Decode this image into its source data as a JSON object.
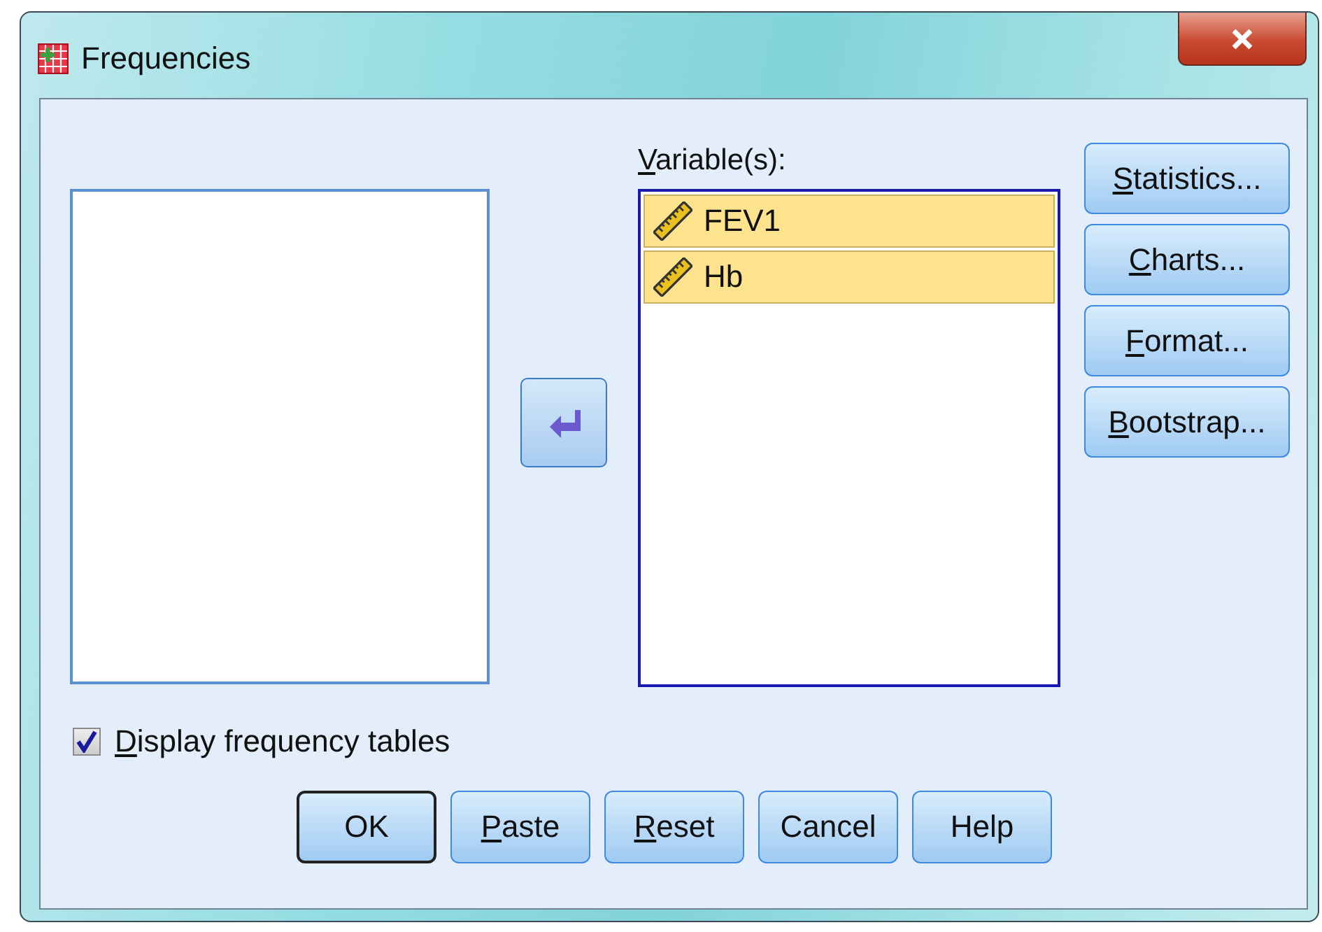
{
  "window": {
    "title": "Frequencies"
  },
  "move_button": {
    "kind": "move-back"
  },
  "variables": {
    "label": "Variable(s):",
    "underline_first": true,
    "items": [
      {
        "name": "FEV1",
        "kind": "scale",
        "selected": true
      },
      {
        "name": "Hb",
        "kind": "scale",
        "selected": true
      }
    ]
  },
  "side_buttons": [
    {
      "label": "Statistics...",
      "underline_first": true
    },
    {
      "label": "Charts...",
      "underline_first": true
    },
    {
      "label": "Format...",
      "underline_first": true
    },
    {
      "label": "Bootstrap...",
      "underline_first": true
    }
  ],
  "display_frequency_tables": {
    "label": "Display frequency tables",
    "underline_first": true,
    "checked": true
  },
  "buttons": [
    {
      "label": "OK",
      "underline_first": false,
      "default": true
    },
    {
      "label": "Paste",
      "underline_first": true,
      "default": false
    },
    {
      "label": "Reset",
      "underline_first": true,
      "default": false
    },
    {
      "label": "Cancel",
      "underline_first": false,
      "default": false
    },
    {
      "label": "Help",
      "underline_first": false,
      "default": false
    }
  ]
}
